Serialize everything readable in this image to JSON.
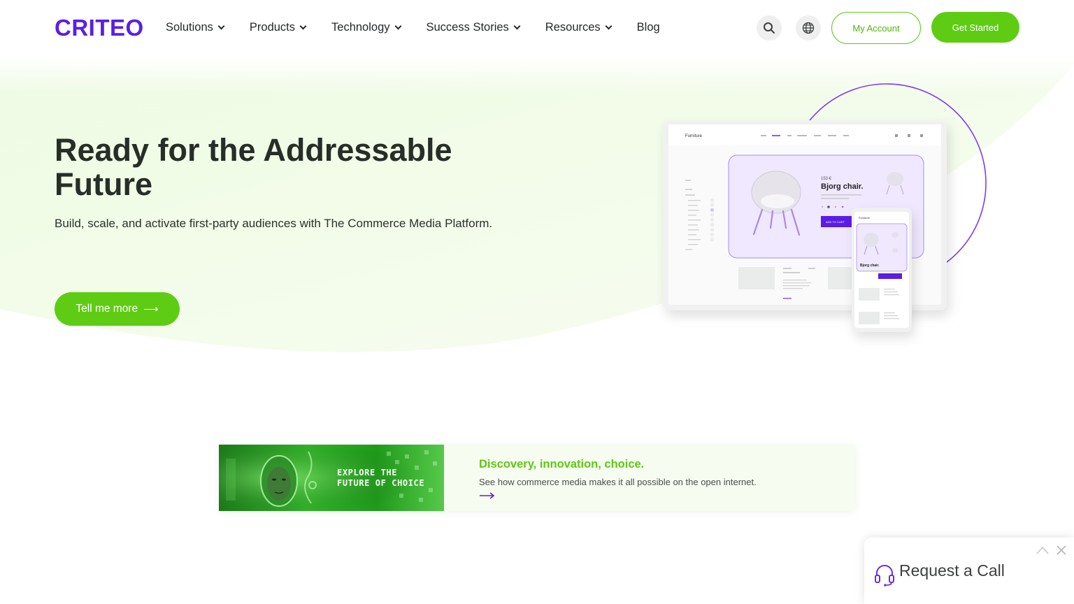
{
  "brand": {
    "logo_text": "CRITEO",
    "accent": "#5a1ee6",
    "green": "#5fcc14"
  },
  "nav": {
    "items": [
      {
        "label": "Solutions",
        "has_dropdown": true
      },
      {
        "label": "Products",
        "has_dropdown": true
      },
      {
        "label": "Technology",
        "has_dropdown": true
      },
      {
        "label": "Success Stories",
        "has_dropdown": true
      },
      {
        "label": "Resources",
        "has_dropdown": true
      },
      {
        "label": "Blog",
        "has_dropdown": false
      }
    ],
    "icons": [
      "search-icon",
      "globe-icon"
    ],
    "account_label": "My Account",
    "get_started_label": "Get Started"
  },
  "hero": {
    "title": "Ready for the Addressable Future",
    "subtitle": "Build, scale, and activate first-party audiences with The Commerce Media Platform.",
    "cta_label": "Tell me more",
    "cta_arrow": "⟶",
    "mockup": {
      "store_name": "Furniture",
      "product_price": "153 €",
      "product_name": "Bjorg chair.",
      "add_to_cart": "ADD TO CART",
      "mobile_store_name": "Furniture",
      "mobile_product_name": "Bjorg chair."
    }
  },
  "promo": {
    "image_text_line1": "EXPLORE THE",
    "image_text_line2": "FUTURE OF CHOICE",
    "title": "Discovery, innovation, choice.",
    "description": "See how commerce media makes it all possible on the open internet."
  },
  "call_widget": {
    "label": "Request a Call",
    "icons": [
      "headset-icon",
      "chevron-up-icon",
      "close-icon"
    ]
  }
}
